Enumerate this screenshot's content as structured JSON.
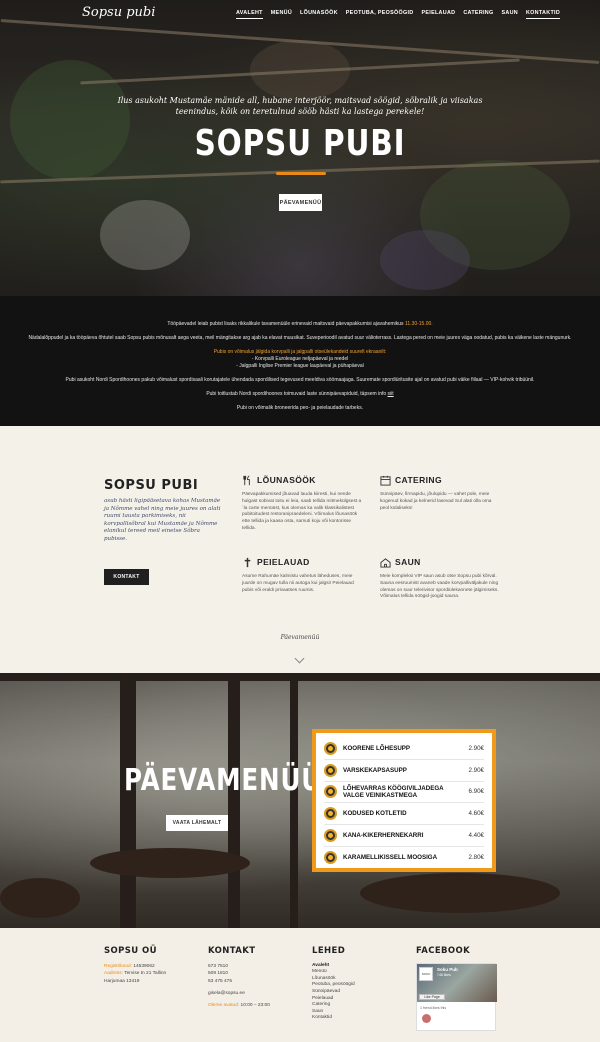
{
  "header": {
    "logo": "Sopsu pubi",
    "nav": [
      "AVALEHT",
      "MENÜÜ",
      "LÕUNASÖÖK",
      "PEOTUBA, PEOSÖÖGID",
      "PEIELAUAD",
      "CATERING",
      "SAUN",
      "KONTAKTID"
    ]
  },
  "hero": {
    "tagline": "Ilus asukoht Mustamäe mänide all, hubane interjöör, maitsvad söögid, sõbralik ja viisakas teenindus, kõik on teretulnud sööb hästi ka lastega perekele!",
    "title": "SOPSU PUBI",
    "button": "PÄEVAMENÜÜ"
  },
  "info": {
    "p1": "Tööpäevadel leiab pubist lisaks rikkalikule tavamenüüle erinevaid maitsvaid päevapakkumisi ajavahemikus",
    "p1_time": "11.30-15.00.",
    "p2": "Nädalalõppudel ja ka tööpäeva õhtutel saab Sopsu pubis mõnusalt aega veeta, meil mängitakse arg ajab ka elavat muusikat. Suveperioodil avatud suur välioterrass. Lastega pered on meie juures väga oodatud, pubis ka väikene laste mängunurk.",
    "p3": "Pubis on võimalus jälgida korvpalli ja jalgpalli otseülekandeid suurelt ekraanilt:",
    "p4": "- Korvpalli Euroleague neljapäeval ja reedel",
    "p5": "- Jalgpalli Inglise Premier league laupäeval ja pühapäeval",
    "p6": "Pubi asukoht Nordi Spordihoones pakub võimalust spordisaali korutajatele ühendada spordilised tegevused meeldiva söömaajaga. Suuremate spordiüritusite ajal on avatud pubi väike fiilaal — VIP-kohvik tribüünil.",
    "p7": "Pubi toitlustab Nordi spordihoones toimuvaid laste sünnipäevapiduid, täpsem info",
    "p7_link": "siit",
    "p8": "Pubi on võimalik broneerida peo- ja peielaudade tarbeks."
  },
  "features": {
    "title": "SOPSU PUBI",
    "text": "asub hästi ligipääsetava kohas Mustamäe ja Nõmme vahel ning meie juures on alati ruumi tausta parkimiseks, nii korvpallisõbral kui Mustamäe ja Nõmme elanikul tereed meil einetse Sõbra pubisse.",
    "button": "KONTAKT",
    "items": [
      {
        "title": "LÕUNASÖÖK",
        "icon": "lunch-icon",
        "text": "Päevapakkumised jõuavad lauda kiiresti, kui nende hulgast sobivat toitu ei leia, saab tellida mitmekülgsest a´la carte menüüst, kus olemas ka valik klassikalistest pubitoitudest restoraniprae­deleni. Võimalus lõunasöök ette tellida ja kaasa osta, samuti koju või kontorisse tellida."
      },
      {
        "title": "CATERING",
        "icon": "catering-icon",
        "text": "Sünnipäev, firmapidu, jõulupidu — vahet pole, meie kogenud kokad ja kelnerid lasevad Sul alati olla oma peol külaliseks!"
      },
      {
        "title": "PEIELAUAD",
        "icon": "cross-icon",
        "text": "Asume Rahumäe kalmistu vahetus läheduses, meie juurde on mugav tulla nii autoga kui jalgsi! Peielauad pubis või eraldi privaatses ruumis."
      },
      {
        "title": "SAUN",
        "icon": "sauna-icon",
        "text": "Meie kompleksi VIP saun asub otse Sopsu pubi kõrval. Sauna eesruumist avaneb vaade korvpallivälj­akule ning olemas on suur telerivisor spordiülekannete jälgimiseks. Võimalus tellida söögid-joogid sauna."
      }
    ],
    "menu_link": "Päevamenüü"
  },
  "daily": {
    "title": "PÄEVAMENÜÜ",
    "button": "VAATA LÄHEMALT",
    "items": [
      {
        "name": "KOORENE LÕHESUPP",
        "price": "2.90€"
      },
      {
        "name": "VARSKEKAPSASUPP",
        "price": "2.90€"
      },
      {
        "name": "LÕHEVARRAS KÖÖGIVILJADEGA VALGE VEINIKASTMEGA",
        "price": "6.90€"
      },
      {
        "name": "KODUSED KOTLETID",
        "price": "4.60€"
      },
      {
        "name": "KANA-KIKERHERNEKARRI",
        "price": "4.40€"
      },
      {
        "name": "KARAMELLIKISSELL MOOSIGA",
        "price": "2.80€"
      }
    ]
  },
  "footer": {
    "company": {
      "title": "SOPSU OÜ",
      "reg_label": "Registrikood:",
      "reg_value": "14539062",
      "addr_label": "Aadress:",
      "addr_value": "Tervise tn 21 Tallinn",
      "addr_line2": "Harjumaa 13419"
    },
    "contact": {
      "title": "KONTAKT",
      "phones": [
        "673 7510",
        "509 1810",
        "53 475 475"
      ],
      "email": "gisela@sopsu.ee",
      "hours_label": "Oleme avatud:",
      "hours_value": "10:00 – 23:00"
    },
    "pages": {
      "title": "LEHED",
      "links": [
        "Avaleht",
        "Menüü",
        "Lõunasöök",
        "Peotuba, peosöögid",
        "Sünnipäevad",
        "Peielauad",
        "Catering",
        "Saun",
        "Kontaktid"
      ]
    },
    "facebook": {
      "title": "FACEBOOK",
      "page_name": "Soku Pub",
      "likes": "748 likes",
      "like_button": "Like Page",
      "friends": "1 friend likes this"
    }
  },
  "colors": {
    "accent": "#e98a17",
    "dark": "#121212",
    "cream": "#f4f1e9",
    "menu_border": "#f09a1c"
  }
}
